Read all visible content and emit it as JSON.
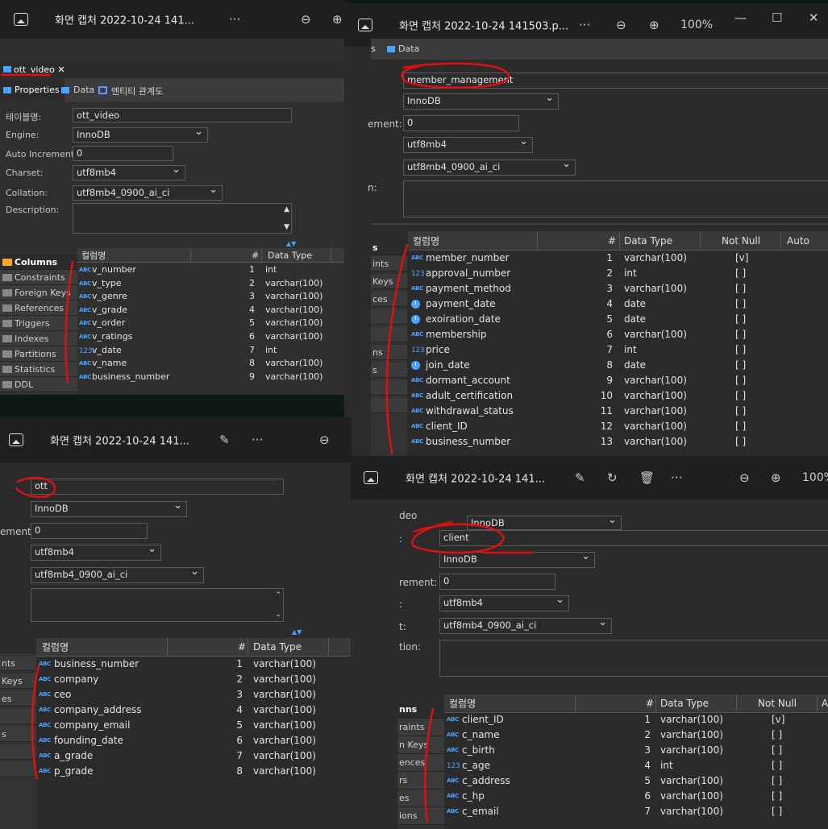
{
  "common": {
    "col_header_name": "컬럼명",
    "col_header_num": "#",
    "col_header_type": "Data Type",
    "col_header_notnull": "Not Null",
    "col_header_auto": "Auto",
    "col_header_a": "A",
    "more": "···"
  },
  "w1": {
    "title": "화면 캡처 2022-10-24 141...",
    "tab": "ott_video",
    "subtabs": [
      "Properties",
      "Data",
      "엔티티 관계도"
    ],
    "labels": {
      "table": "테이블명:",
      "engine": "Engine:",
      "auto": "Auto Increment:",
      "charset": "Charset:",
      "collation": "Collation:",
      "desc": "Description:"
    },
    "values": {
      "table": "ott_video",
      "engine": "InnoDB",
      "auto": "0",
      "charset": "utf8mb4",
      "collation": "utf8mb4_0900_ai_ci"
    },
    "side": [
      "Columns",
      "Constraints",
      "Foreign Keys",
      "References",
      "Triggers",
      "Indexes",
      "Partitions",
      "Statistics",
      "DDL"
    ],
    "rows": [
      {
        "icon": "ABC",
        "name": "v_number",
        "num": "1",
        "type": "int"
      },
      {
        "icon": "ABC",
        "name": "v_type",
        "num": "2",
        "type": "varchar(100)"
      },
      {
        "icon": "ABC",
        "name": "v_genre",
        "num": "3",
        "type": "varchar(100)"
      },
      {
        "icon": "ABC",
        "name": "v_grade",
        "num": "4",
        "type": "varchar(100)"
      },
      {
        "icon": "ABC",
        "name": "v_order",
        "num": "5",
        "type": "varchar(100)"
      },
      {
        "icon": "ABC",
        "name": "v_ratings",
        "num": "6",
        "type": "varchar(100)"
      },
      {
        "icon": "123",
        "name": "v_date",
        "num": "7",
        "type": "int"
      },
      {
        "icon": "ABC",
        "name": "v_name",
        "num": "8",
        "type": "varchar(100)"
      },
      {
        "icon": "ABC",
        "name": "business_number",
        "num": "9",
        "type": "varchar(100)"
      }
    ]
  },
  "w2": {
    "title": "화면 캡처 2022-10-24 141503.p...",
    "zoom": "100%",
    "tab_frag_1": "s",
    "tab_frag_2": "Data",
    "label_frags": {
      "auto": "ement:",
      "desc": "n:"
    },
    "values": {
      "table": "member_management",
      "engine": "InnoDB",
      "auto": "0",
      "charset": "utf8mb4",
      "collation": "utf8mb4_0900_ai_ci"
    },
    "side": [
      "s",
      "ints",
      "Keys",
      "ces",
      "",
      "",
      "ns",
      "s",
      "",
      ""
    ],
    "rows": [
      {
        "icon": "ABC",
        "name": "member_number",
        "num": "1",
        "type": "varchar(100)",
        "nn": "[v]"
      },
      {
        "icon": "123",
        "name": "approval_number",
        "num": "2",
        "type": "int",
        "nn": "[ ]"
      },
      {
        "icon": "ABC",
        "name": "payment_method",
        "num": "3",
        "type": "varchar(100)",
        "nn": "[ ]"
      },
      {
        "icon": "clock",
        "name": "payment_date",
        "num": "4",
        "type": "date",
        "nn": "[ ]"
      },
      {
        "icon": "clock",
        "name": "exoiration_date",
        "num": "5",
        "type": "date",
        "nn": "[ ]"
      },
      {
        "icon": "ABC",
        "name": "membership",
        "num": "6",
        "type": "varchar(100)",
        "nn": "[ ]"
      },
      {
        "icon": "123",
        "name": "price",
        "num": "7",
        "type": "int",
        "nn": "[ ]"
      },
      {
        "icon": "clock",
        "name": "join_date",
        "num": "8",
        "type": "date",
        "nn": "[ ]"
      },
      {
        "icon": "ABC",
        "name": "dormant_account",
        "num": "9",
        "type": "varchar(100)",
        "nn": "[ ]"
      },
      {
        "icon": "ABC",
        "name": "adult_certification",
        "num": "10",
        "type": "varchar(100)",
        "nn": "[ ]"
      },
      {
        "icon": "ABC",
        "name": "withdrawal_status",
        "num": "11",
        "type": "varchar(100)",
        "nn": "[ ]"
      },
      {
        "icon": "ABC",
        "name": "client_ID",
        "num": "12",
        "type": "varchar(100)",
        "nn": "[ ]"
      },
      {
        "icon": "ABC",
        "name": "business_number",
        "num": "13",
        "type": "varchar(100)",
        "nn": "[ ]"
      }
    ]
  },
  "w3": {
    "title": "화면 캡처 2022-10-24 141...",
    "label_frags": {
      "auto": "ement:"
    },
    "values": {
      "table": "ott",
      "engine": "InnoDB",
      "auto": "0",
      "charset": "utf8mb4",
      "collation": "utf8mb4_0900_ai_ci"
    },
    "side": [
      "",
      "nts",
      "Keys",
      "es",
      "",
      "s",
      "",
      ""
    ],
    "rows": [
      {
        "icon": "ABC",
        "name": "business_number",
        "num": "1",
        "type": "varchar(100)"
      },
      {
        "icon": "ABC",
        "name": "company",
        "num": "2",
        "type": "varchar(100)"
      },
      {
        "icon": "ABC",
        "name": "ceo",
        "num": "3",
        "type": "varchar(100)"
      },
      {
        "icon": "ABC",
        "name": "company_address",
        "num": "4",
        "type": "varchar(100)"
      },
      {
        "icon": "ABC",
        "name": "company_email",
        "num": "5",
        "type": "varchar(100)"
      },
      {
        "icon": "ABC",
        "name": "founding_date",
        "num": "6",
        "type": "varchar(100)"
      },
      {
        "icon": "ABC",
        "name": "a_grade",
        "num": "7",
        "type": "varchar(100)"
      },
      {
        "icon": "ABC",
        "name": "p_grade",
        "num": "8",
        "type": "varchar(100)"
      }
    ]
  },
  "w4": {
    "title": "화면 캡처 2022-10-24 141...",
    "zoom": "100%",
    "label_frags": {
      "top": "deo",
      "table": ":",
      "auto": "rement:",
      "charset": ":",
      "collation": "t:",
      "desc": "tion:"
    },
    "values": {
      "top": "InnoDB",
      "table": "client",
      "engine": "InnoDB",
      "auto": "0",
      "charset": "utf8mb4",
      "collation": "utf8mb4_0900_ai_ci"
    },
    "side": [
      "nns",
      "raints",
      "n Keys",
      "ences",
      "rs",
      "es",
      "ions"
    ],
    "rows": [
      {
        "icon": "ABC",
        "name": "client_ID",
        "num": "1",
        "type": "varchar(100)",
        "nn": "[v]"
      },
      {
        "icon": "ABC",
        "name": "c_name",
        "num": "2",
        "type": "varchar(100)",
        "nn": "[ ]"
      },
      {
        "icon": "ABC",
        "name": "c_birth",
        "num": "3",
        "type": "varchar(100)",
        "nn": "[ ]"
      },
      {
        "icon": "123",
        "name": "c_age",
        "num": "4",
        "type": "int",
        "nn": "[ ]"
      },
      {
        "icon": "ABC",
        "name": "c_address",
        "num": "5",
        "type": "varchar(100)",
        "nn": "[ ]"
      },
      {
        "icon": "ABC",
        "name": "c_hp",
        "num": "6",
        "type": "varchar(100)",
        "nn": "[ ]"
      },
      {
        "icon": "ABC",
        "name": "c_email",
        "num": "7",
        "type": "varchar(100)",
        "nn": "[ ]"
      }
    ]
  }
}
